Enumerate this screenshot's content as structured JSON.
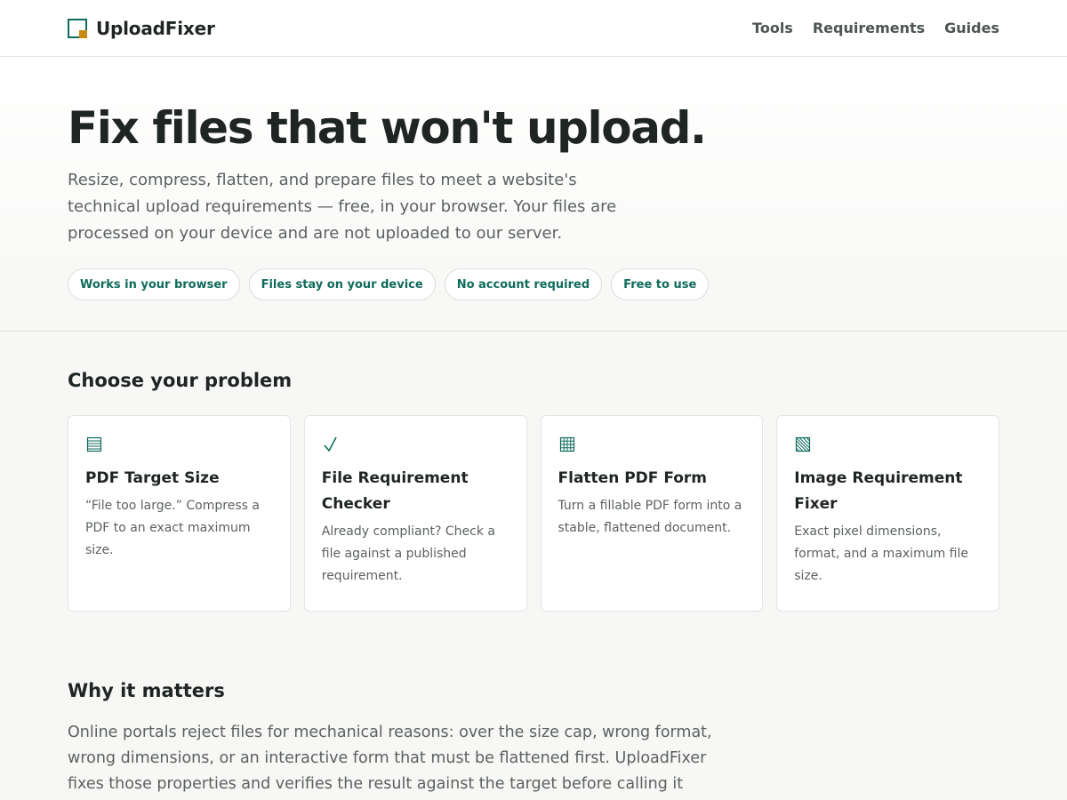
{
  "header": {
    "brand": "UploadFixer",
    "nav": [
      {
        "label": "Tools"
      },
      {
        "label": "Requirements"
      },
      {
        "label": "Guides"
      }
    ]
  },
  "hero": {
    "title": "Fix files that won't upload.",
    "lead": "Resize, compress, flatten, and prepare files to meet a website's technical upload requirements — free, in your browser. Your files are processed on your device and are not uploaded to our server.",
    "chips": [
      "Works in your browser",
      "Files stay on your device",
      "No account required",
      "Free to use"
    ]
  },
  "problems": {
    "title": "Choose your problem",
    "cards": [
      {
        "icon": "document-lines-icon",
        "title": "PDF Target Size",
        "desc": "“File too large.” Compress a PDF to an exact maximum size."
      },
      {
        "icon": "checkmark-icon",
        "title": "File Requirement Checker",
        "desc": "Already compliant? Check a file against a published requirement."
      },
      {
        "icon": "grid-icon",
        "title": "Flatten PDF Form",
        "desc": "Turn a fillable PDF form into a stable, flattened document."
      },
      {
        "icon": "hatched-image-icon",
        "title": "Image Requirement Fixer",
        "desc": "Exact pixel dimensions, format, and a maximum file size."
      }
    ]
  },
  "why": {
    "title": "Why it matters",
    "body": "Online portals reject files for mechanical reasons: over the size cap, wrong format, wrong dimensions, or an interactive form that must be flattened first. UploadFixer fixes those properties and verifies the result against the target before calling it done. For the exact"
  },
  "colors": {
    "accent": "#0f6b5c",
    "logo_accent": "#c98a10",
    "text": "#1f2523",
    "muted": "#5b625f"
  }
}
